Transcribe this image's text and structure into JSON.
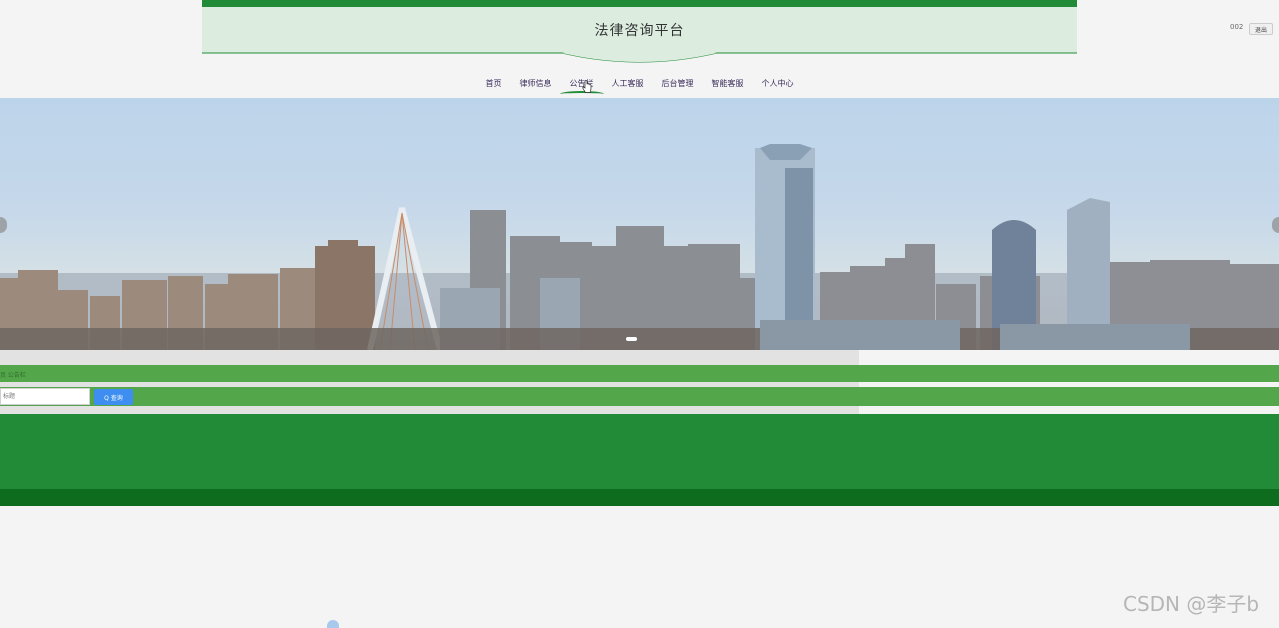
{
  "header": {
    "title": "法律咨询平台"
  },
  "user": {
    "id": "002",
    "logout_label": "退出"
  },
  "nav": {
    "items": [
      {
        "label": "首页"
      },
      {
        "label": "律师信息"
      },
      {
        "label": "公告栏"
      },
      {
        "label": "人工客服"
      },
      {
        "label": "后台管理"
      },
      {
        "label": "智能客服"
      },
      {
        "label": "个人中心"
      }
    ],
    "active_index": 2
  },
  "banner": {
    "slides": 1,
    "active_slide": 1
  },
  "breadcrumb": {
    "text": "页  公告栏"
  },
  "search": {
    "placeholder": "标题",
    "button_label": "Q 查询"
  },
  "watermark": "CSDN @李子b",
  "colors": {
    "brand_green": "#228b38",
    "dark_green": "#0e6c1f",
    "light_green": "#54a64a",
    "header_bg": "#dcede0",
    "button_blue": "#3d8ef0"
  }
}
